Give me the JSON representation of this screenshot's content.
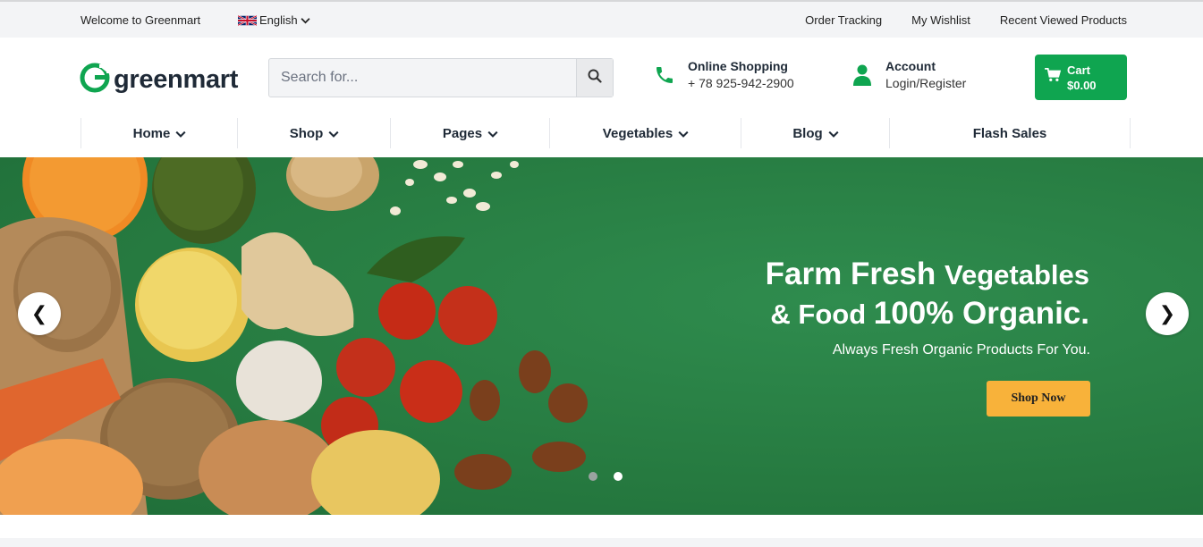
{
  "topbar": {
    "welcome": "Welcome to Greenmart",
    "language": "English",
    "links": [
      "Order Tracking",
      "My Wishlist",
      "Recent Viewed Products"
    ]
  },
  "header": {
    "logo_text": "greenmart",
    "search_placeholder": "Search for...",
    "contact_title": "Online Shopping",
    "contact_phone": "+ 78 925-942-2900",
    "account_title": "Account",
    "account_sub": "Login/Register",
    "cart_label": "Cart",
    "cart_total": "$0.00"
  },
  "nav": {
    "items": [
      "Home",
      "Shop",
      "Pages",
      "Vegetables",
      "Blog",
      "Flash Sales"
    ]
  },
  "hero": {
    "title_line1_a": "Farm Fresh",
    "title_line1_b": "Vegetables",
    "title_line2_a": "& Food",
    "title_line2_b": "100% Organic.",
    "subtitle": "Always Fresh Organic Products For You.",
    "button": "Shop Now",
    "prev": "❮",
    "next": "❯",
    "slides": 2,
    "active_slide": 2
  },
  "colors": {
    "brand_green": "#0fa550",
    "hero_green": "#2a8346",
    "button_orange": "#f8b23a",
    "dot_inactive": "#9aa3a0",
    "dot_active": "#ffffff"
  },
  "icons": {
    "search": "search-icon",
    "phone": "phone-icon",
    "account": "user-icon",
    "cart": "cart-icon",
    "dropdown": "chevron-down-icon"
  }
}
